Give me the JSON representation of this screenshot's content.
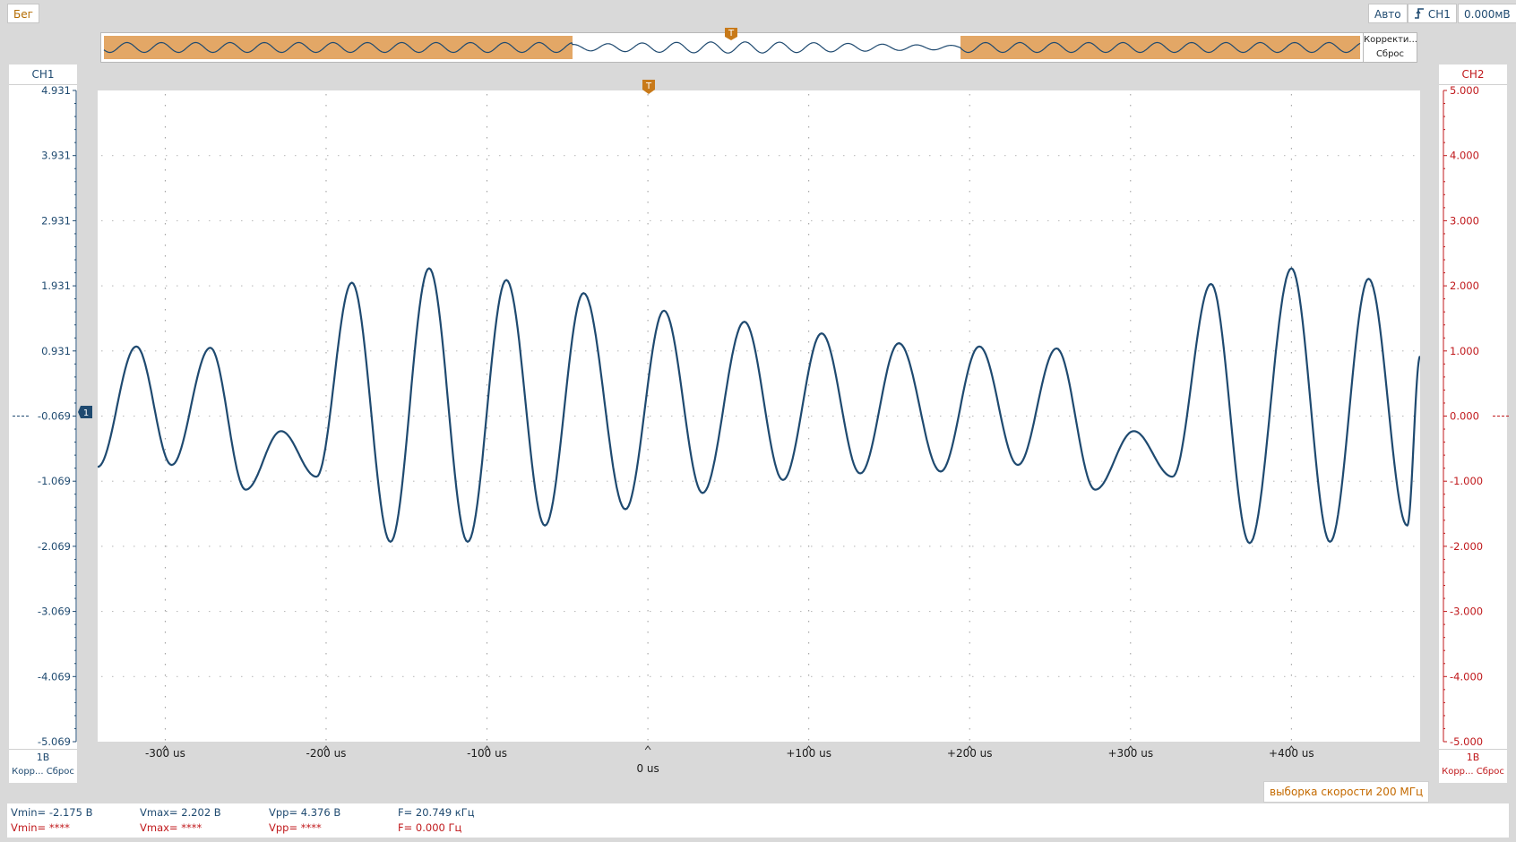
{
  "toolbar": {
    "run_label": "Бег",
    "mode_label": "Авто",
    "trigger_channel": "CH1",
    "trigger_level": "0.000мВ"
  },
  "overview": {
    "correct_label": "Корректи...",
    "reset_label": "Сброс",
    "trigger_marker": "T"
  },
  "ch1": {
    "name": "CH1",
    "color": "#1f4a70",
    "scale": "1В",
    "corr_label": "Корр...",
    "reset_label": "Сброс",
    "ticks": [
      "4.931",
      "3.931",
      "2.931",
      "1.931",
      "0.931",
      "-0.069",
      "-1.069",
      "-2.069",
      "-3.069",
      "-4.069",
      "-5.069"
    ],
    "marker": "1"
  },
  "ch2": {
    "name": "CH2",
    "color": "#c0191c",
    "scale": "1В",
    "corr_label": "Корр...",
    "reset_label": "Сброс",
    "ticks": [
      "5.000",
      "4.000",
      "3.000",
      "2.000",
      "1.000",
      "0.000",
      "-1.000",
      "-2.000",
      "-3.000",
      "-4.000",
      "-5.000"
    ]
  },
  "time_axis": {
    "labels": [
      "-300 us",
      "-200 us",
      "-100 us",
      "0 us",
      "+100 us",
      "+200 us",
      "+300 us",
      "+400 us"
    ],
    "values": [
      -300,
      -200,
      -100,
      0,
      100,
      200,
      300,
      400
    ]
  },
  "trigger_marker": "T",
  "sample_rate": "выборка скорости 200 МГц",
  "measurements": {
    "ch1": {
      "vmin": "Vmin= -2.175 В",
      "vmax": "Vmax= 2.202 В",
      "vpp": "Vpp= 4.376 В",
      "freq": "F= 20.749 кГц"
    },
    "ch2": {
      "vmin": "Vmin= ****",
      "vmax": "Vmax= ****",
      "vpp": "Vpp= ****",
      "freq": "F= 0.000 Гц"
    }
  },
  "chart_data": {
    "type": "line",
    "x_unit": "us",
    "x_range": [
      -342,
      480
    ],
    "y_range": [
      -5.069,
      4.931
    ],
    "grid": true,
    "series": [
      {
        "color": "#1f4a70",
        "x": [
          -342,
          -318,
          -296,
          -272,
          -250,
          -228,
          -206,
          -184,
          -160,
          -136,
          -112,
          -88,
          -64,
          -40,
          -14,
          10,
          34,
          60,
          84,
          108,
          132,
          156,
          182,
          206,
          230,
          254,
          278,
          302,
          326,
          350,
          374,
          400,
          424,
          448,
          472,
          480
        ],
        "y": [
          -0.85,
          1.0,
          -0.82,
          0.98,
          -1.2,
          -0.3,
          -1.0,
          1.98,
          -2.0,
          2.2,
          -2.0,
          2.02,
          -1.75,
          1.82,
          -1.5,
          1.55,
          -1.25,
          1.38,
          -1.05,
          1.2,
          -0.95,
          1.05,
          -0.92,
          1.0,
          -0.82,
          0.97,
          -1.2,
          -0.3,
          -1.0,
          1.96,
          -2.02,
          2.2,
          -2.0,
          2.04,
          -1.75,
          0.85
        ]
      }
    ]
  }
}
